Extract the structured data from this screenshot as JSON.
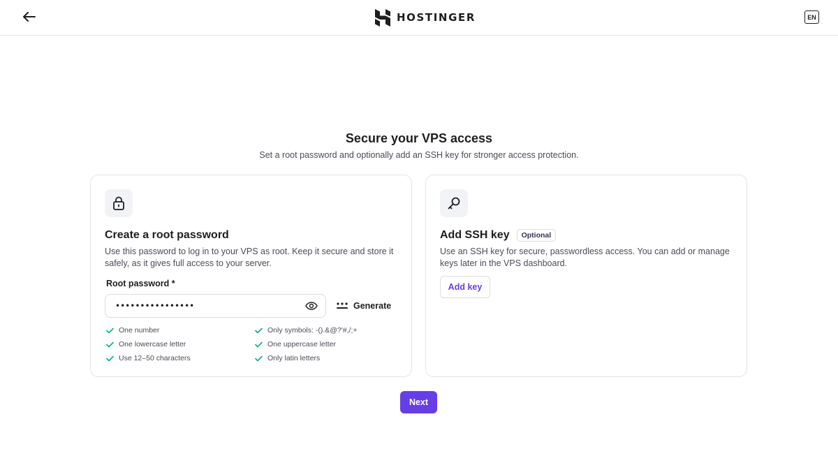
{
  "header": {
    "brand": "HOSTINGER",
    "language": "EN"
  },
  "page": {
    "title": "Secure your VPS access",
    "subtitle": "Set a root password and optionally add an SSH key for stronger access protection."
  },
  "root_password_card": {
    "title": "Create a root password",
    "description": "Use this password to log in to your VPS as root. Keep it secure and store it safely, as it gives full access to your server.",
    "field_label": "Root password *",
    "password_value": "••••••••••••••••",
    "generate_label": "Generate",
    "requirements": [
      {
        "text": "One number",
        "met": true
      },
      {
        "text": "Only symbols: -().&@?'#,/;+",
        "met": true
      },
      {
        "text": "One lowercase letter",
        "met": true
      },
      {
        "text": "One uppercase letter",
        "met": true
      },
      {
        "text": "Use 12–50 characters",
        "met": true
      },
      {
        "text": "Only latin letters",
        "met": true
      }
    ]
  },
  "ssh_card": {
    "title": "Add SSH key",
    "badge": "Optional",
    "description": "Use an SSH key for secure, passwordless access. You can add or manage keys later in the VPS dashboard.",
    "add_key_label": "Add key"
  },
  "footer": {
    "next_label": "Next"
  },
  "colors": {
    "primary": "#673de6",
    "check": "#00b090",
    "text": "#1d1e20",
    "muted": "#4a4b57",
    "border": "#e4e4e8"
  }
}
